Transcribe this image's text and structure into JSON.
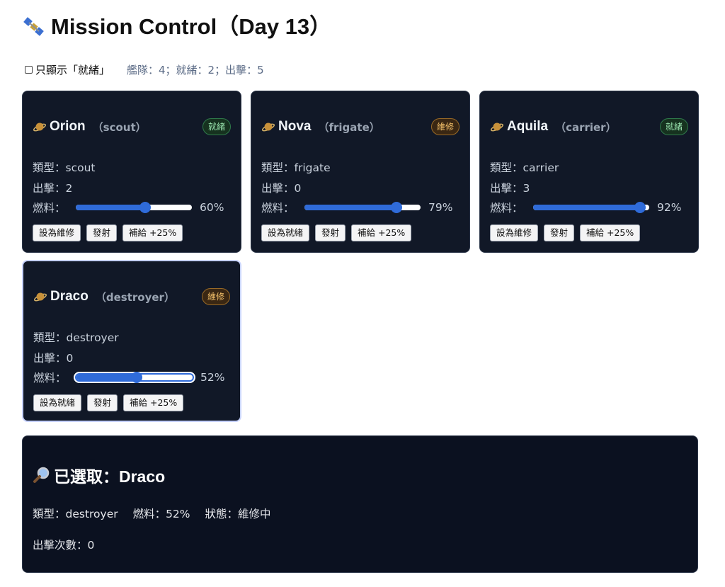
{
  "page": {
    "title": "Mission Control（Day 13）"
  },
  "filter": {
    "label": "只顯示「就緒」",
    "checked": false,
    "summary": "艦隊：4；就緒：2；出擊：5"
  },
  "labels": {
    "type": "類型：",
    "sorties": "出擊：",
    "fuel": "燃料："
  },
  "ships": [
    {
      "name": "Orion",
      "type_paren": "（scout）",
      "type": "scout",
      "status": "就緒",
      "status_kind": "ready",
      "sorties": "2",
      "fuel": 60,
      "fuel_text": "60%",
      "toggle_label": "設為維修",
      "launch_label": "發射",
      "refuel_label": "補給 +25%",
      "selected": false
    },
    {
      "name": "Nova",
      "type_paren": "（frigate）",
      "type": "frigate",
      "status": "維修",
      "status_kind": "repair",
      "sorties": "0",
      "fuel": 79,
      "fuel_text": "79%",
      "toggle_label": "設為就緒",
      "launch_label": "發射",
      "refuel_label": "補給 +25%",
      "selected": false
    },
    {
      "name": "Aquila",
      "type_paren": "（carrier）",
      "type": "carrier",
      "status": "就緒",
      "status_kind": "ready",
      "sorties": "3",
      "fuel": 92,
      "fuel_text": "92%",
      "toggle_label": "設為維修",
      "launch_label": "發射",
      "refuel_label": "補給 +25%",
      "selected": false
    },
    {
      "name": "Draco",
      "type_paren": "（destroyer）",
      "type": "destroyer",
      "status": "維修",
      "status_kind": "repair",
      "sorties": "0",
      "fuel": 52,
      "fuel_text": "52%",
      "toggle_label": "設為就緒",
      "launch_label": "發射",
      "refuel_label": "補給 +25%",
      "selected": true
    }
  ],
  "detail": {
    "title": "已選取：Draco",
    "type_text": "類型：destroyer",
    "fuel_text": "燃料：52%",
    "status_text": "狀態：維修中",
    "sorties_text": "出擊次數：0"
  },
  "colors": {
    "card_bg": "#111827",
    "accent": "#2f6bd9",
    "ready": "#9be7b0",
    "repair": "#f5c26b"
  },
  "icons": {
    "title": "satellite-icon",
    "ship": "planet-icon",
    "detail": "magnifier-icon"
  }
}
